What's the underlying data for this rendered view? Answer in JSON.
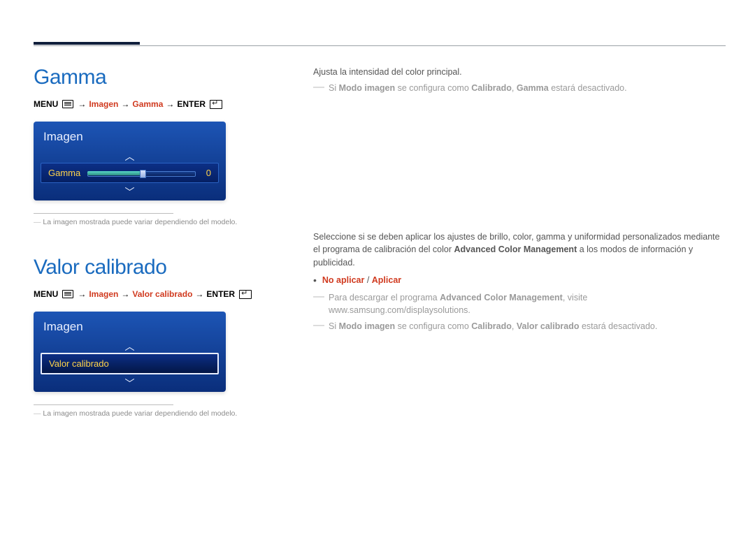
{
  "section1": {
    "title": "Gamma",
    "breadcrumb": {
      "menu": "MENU",
      "p1": "Imagen",
      "p2": "Gamma",
      "enter": "ENTER"
    },
    "osd": {
      "title": "Imagen",
      "row_label": "Gamma",
      "row_value": "0"
    },
    "footnote": "La imagen mostrada puede variar dependiendo del modelo.",
    "desc": "Ajusta la intensidad del color principal.",
    "note1": {
      "pre": "Si ",
      "kw1": "Modo imagen",
      "mid": " se configura como ",
      "kw2": "Calibrado",
      "mid2": ", ",
      "kw3": "Gamma",
      "post": " estará desactivado."
    }
  },
  "section2": {
    "title": "Valor calibrado",
    "breadcrumb": {
      "menu": "MENU",
      "p1": "Imagen",
      "p2": "Valor calibrado",
      "enter": "ENTER"
    },
    "osd": {
      "title": "Imagen",
      "row_label": "Valor calibrado"
    },
    "footnote": "La imagen mostrada puede variar dependiendo del modelo.",
    "desc_a": "Seleccione si se deben aplicar los ajustes de brillo, color, gamma y uniformidad personalizados mediante el programa de calibración del color ",
    "desc_b_bold": "Advanced Color Management",
    "desc_c": " a los modos de información y publicidad.",
    "options": {
      "opt1": "No aplicar",
      "sep": " / ",
      "opt2": "Aplicar"
    },
    "note_dl": {
      "pre": "Para descargar el programa ",
      "kw": "Advanced Color Management",
      "post": ", visite www.samsung.com/displaysolutions."
    },
    "note_off": {
      "pre": "Si ",
      "kw1": "Modo imagen",
      "mid": " se configura como ",
      "kw2": "Calibrado",
      "mid2": ", ",
      "kw3": "Valor calibrado",
      "post": " estará desactivado."
    }
  }
}
